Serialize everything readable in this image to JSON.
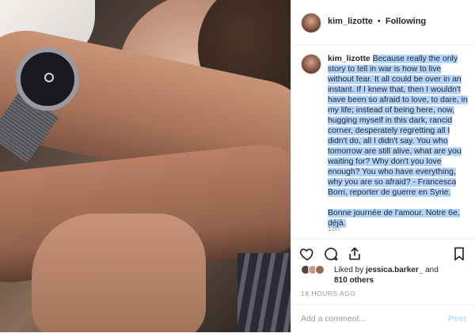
{
  "post": {
    "username": "kim_lizotte",
    "separator": "•",
    "follow_status": "Following"
  },
  "comment": {
    "username": "kim_lizotte",
    "text_highlighted": "Because really the only story to tell in war is how to live without fear. It all could be over in an instant. If I knew that, then I wouldn't have been so afraid to love, to dare, in my life; instead of being here, now, hugging myself in this dark, rancid corner, desperately regretting all I didn't do, all I didn't say. You who tomorrow are still alive, what are you waiting for? Why don't you love enough? You who have everything, why you are so afraid? - Francesca Borri, reporter de guerre en Syrie.",
    "text_second": "Bonne journée de l'amour. Notre 6e, déjà.",
    "time": "18h"
  },
  "actions": {
    "like_icon": "heart-icon",
    "comment_icon": "comment-icon",
    "share_icon": "share-icon",
    "save_icon": "bookmark-icon"
  },
  "likes": {
    "prefix": "Liked by",
    "user": "jessica.barker_",
    "conjunction": "and",
    "others": "810 others"
  },
  "age": "18 HOURS AGO",
  "add_comment": {
    "placeholder": "Add a comment...",
    "post_label": "Post"
  },
  "colors": {
    "highlight": "#b3d4fc",
    "post_disabled": "#b2dffc",
    "text": "#262626",
    "muted": "#999999"
  }
}
